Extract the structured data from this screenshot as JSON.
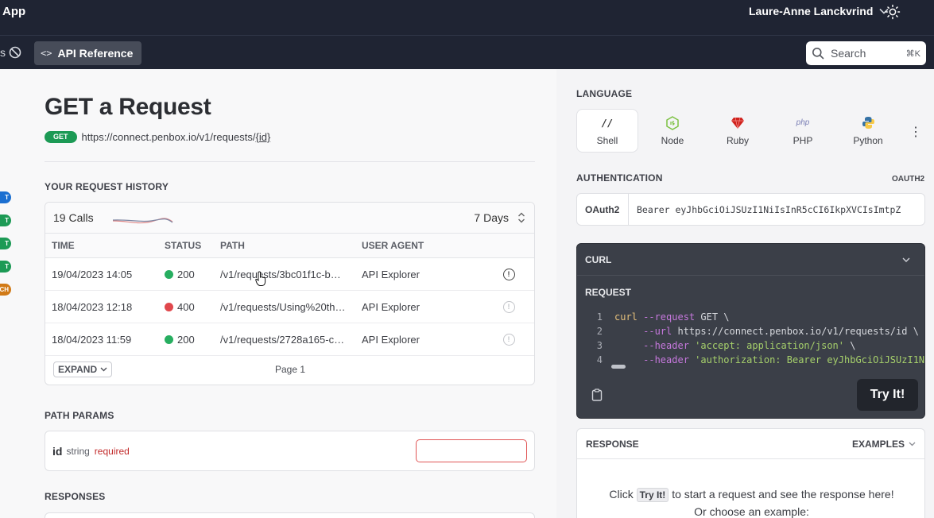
{
  "header": {
    "app_label": "App",
    "user_name": "Laure-Anne Lanckvrind",
    "chevron": "⌄"
  },
  "nav": {
    "truncated_item": "s",
    "api_reference": "API Reference",
    "code_icon": "<>",
    "search_placeholder": "Search",
    "search_shortcut": "⌘K"
  },
  "side_methods": [
    {
      "label": "T",
      "color": "#1b6fd1"
    },
    {
      "label": "T",
      "color": "#1c9a55"
    },
    {
      "label": "T",
      "color": "#1c9a55"
    },
    {
      "label": "T",
      "color": "#1c9a55"
    },
    {
      "label": "CH",
      "color": "#d17a17"
    }
  ],
  "page": {
    "title": "GET a Request",
    "method": "GET",
    "url_prefix": "https://connect.penbox.io/v1/requests/",
    "url_param": "{id}"
  },
  "history": {
    "section_label": "YOUR REQUEST HISTORY",
    "calls": "19 Calls",
    "range": "7 Days",
    "columns": [
      "TIME",
      "STATUS",
      "PATH",
      "USER AGENT"
    ],
    "rows": [
      {
        "time": "19/04/2023 14:05",
        "status": "200",
        "status_color": "#27ae60",
        "path": "/v1/requests/3bc01f1c-b…",
        "agent": "API Explorer",
        "info_faint": false
      },
      {
        "time": "18/04/2023 12:18",
        "status": "400",
        "status_color": "#e0474c",
        "path": "/v1/requests/Using%20th…",
        "agent": "API Explorer",
        "info_faint": true
      },
      {
        "time": "18/04/2023 11:59",
        "status": "200",
        "status_color": "#27ae60",
        "path": "/v1/requests/2728a165-c…",
        "agent": "API Explorer",
        "info_faint": true
      }
    ],
    "expand_label": "EXPAND",
    "page_label": "Page 1"
  },
  "path_params": {
    "section_label": "PATH PARAMS",
    "name": "id",
    "type": "string",
    "required": "required",
    "value": ""
  },
  "responses": {
    "section_label": "RESPONSES"
  },
  "language": {
    "section_label": "LANGUAGE",
    "items": [
      {
        "label": "Shell",
        "icon": "shell-icon",
        "active": true
      },
      {
        "label": "Node",
        "icon": "node-icon",
        "active": false
      },
      {
        "label": "Ruby",
        "icon": "ruby-icon",
        "active": false
      },
      {
        "label": "PHP",
        "icon": "php-icon",
        "active": false
      },
      {
        "label": "Python",
        "icon": "python-icon",
        "active": false
      }
    ],
    "shell_glyph": "//",
    "php_glyph": "php",
    "more_glyph": "⋮"
  },
  "auth": {
    "section_label": "AUTHENTICATION",
    "type_tag": "OAUTH2",
    "kind": "OAuth2",
    "value": "Bearer  eyJhbGciOiJSUzI1NiIsInR5cCI6IkpXVCIsImtpZ"
  },
  "curl": {
    "title": "CURL",
    "request_label": "REQUEST",
    "lines": [
      {
        "n": "1",
        "parts": [
          [
            "k-cmd",
            "curl "
          ],
          [
            "k-flag",
            "--request "
          ],
          [
            "k-plain",
            "GET \\"
          ]
        ]
      },
      {
        "n": "2",
        "parts": [
          [
            "k-plain",
            "     "
          ],
          [
            "k-flag",
            "--url "
          ],
          [
            "k-plain",
            "https://connect.penbox.io/v1/requests/id \\"
          ]
        ]
      },
      {
        "n": "3",
        "parts": [
          [
            "k-plain",
            "     "
          ],
          [
            "k-flag",
            "--header "
          ],
          [
            "k-str",
            "'accept: application/json'"
          ],
          [
            "k-plain",
            " \\"
          ]
        ]
      },
      {
        "n": "4",
        "parts": [
          [
            "k-plain",
            "     "
          ],
          [
            "k-flag",
            "--header "
          ],
          [
            "k-str",
            "'authorization: Bearer eyJhbGciOiJSUzI1N…"
          ]
        ]
      }
    ],
    "try_label": "Try It!"
  },
  "response": {
    "title": "RESPONSE",
    "examples_label": "EXAMPLES",
    "msg_before": "Click",
    "msg_kbd": "Try It!",
    "msg_after": "to start a request and see the response here!",
    "msg_line2": "Or choose an example:"
  },
  "colors": {
    "get_badge": "#1c9a55",
    "topbar": "#1f2433",
    "curl_bg": "#3b3f48"
  }
}
